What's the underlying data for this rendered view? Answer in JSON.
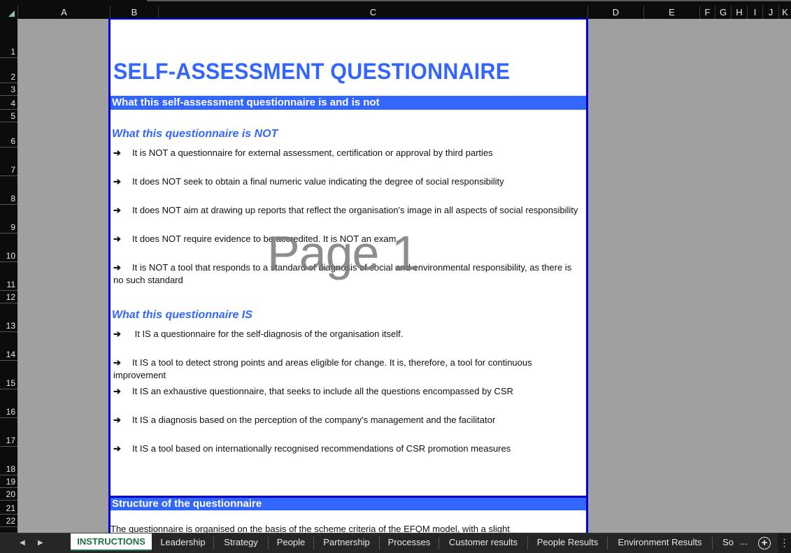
{
  "columns": [
    "A",
    "B",
    "C",
    "D",
    "E",
    "F",
    "G",
    "H",
    "I",
    "J",
    "K"
  ],
  "rows": [
    "1",
    "2",
    "3",
    "4",
    "5",
    "6",
    "7",
    "8",
    "9",
    "10",
    "11",
    "12",
    "13",
    "14",
    "15",
    "16",
    "17",
    "18",
    "19",
    "20",
    "21",
    "22"
  ],
  "sheet": {
    "title": "SELF-ASSESSMENT QUESTIONNAIRE",
    "section1_header": "What this self-assessment questionnaire is and is not",
    "not_heading": "What this questionnaire is NOT",
    "arrow_glyph": "➔",
    "not_items": [
      "It is NOT a questionnaire for external assessment, certification or approval by third parties",
      "It does NOT seek to obtain a final numeric value indicating the degree of social responsibility",
      "It does NOT aim at drawing up reports that reflect the organisation's image in all aspects of social responsibility",
      "It does NOT require evidence to be accredited. It is NOT an exam.",
      "It is NOT a tool that responds to a standard of diagnosis of social and environmental responsibility, as there is no such standard"
    ],
    "is_heading": "What this questionnaire IS",
    "is_items": [
      " It IS a questionnaire for the self-diagnosis of the organisation itself.",
      "It IS a tool to detect strong points and areas eligible for change. It is, therefore, a tool for continuous improvement",
      "It IS  an exhaustive questionnaire, that seeks to include all the questions encompassed by CSR",
      "It IS  a diagnosis based on the perception of the company's management and the facilitator",
      "It IS a tool based on internationally recognised recommendations of CSR promotion measures"
    ],
    "section2_header": "Structure of the questionnaire",
    "section2_partial_text": "The questionnaire is organised on the basis of the scheme criteria of the EFQM model, with a slight",
    "page_watermark": "Page 1"
  },
  "tabs": {
    "prev_icon": "◀",
    "next_icon": "▶",
    "items": [
      {
        "label": "INSTRUCTIONS",
        "active": true
      },
      {
        "label": "Leadership",
        "active": false
      },
      {
        "label": "Strategy",
        "active": false
      },
      {
        "label": "People",
        "active": false
      },
      {
        "label": "Partnership",
        "active": false
      },
      {
        "label": "Processes",
        "active": false
      },
      {
        "label": "Customer results",
        "active": false
      },
      {
        "label": "People Results",
        "active": false
      },
      {
        "label": "Environment Results",
        "active": false
      },
      {
        "label": "So",
        "active": false
      }
    ],
    "overflow": "...",
    "add_icon": "+",
    "menu_icon": "⋮"
  },
  "colors": {
    "accent_blue": "#3366ff",
    "page_border": "#0000d4",
    "active_tab_green": "#1e7145",
    "grid_gray": "#a0a0a0"
  }
}
